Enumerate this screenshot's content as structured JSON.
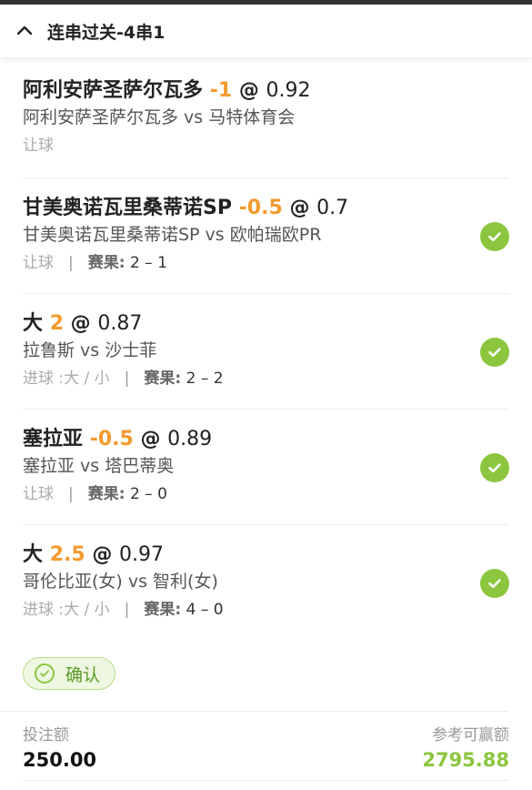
{
  "header": {
    "title": "连串过关-4串1"
  },
  "bets": [
    {
      "selection": "阿利安萨圣萨尔瓦多",
      "handicap": "-1",
      "at": "@",
      "odds": "0.92",
      "match": "阿利安萨圣萨尔瓦多 vs 马特体育会",
      "market": "让球",
      "result_label": "",
      "result": "",
      "won": false
    },
    {
      "selection": "甘美奥诺瓦里桑蒂诺SP",
      "handicap": "-0.5",
      "at": "@",
      "odds": "0.7",
      "match": "甘美奥诺瓦里桑蒂诺SP vs 欧帕瑞欧PR",
      "market": "让球",
      "result_label": "赛果:",
      "result": "2 – 1",
      "won": true
    },
    {
      "selection": "大",
      "handicap": "2",
      "at": "@",
      "odds": "0.87",
      "match": "拉鲁斯 vs 沙士菲",
      "market": "进球 :大 / 小",
      "result_label": "赛果:",
      "result": "2 – 2",
      "won": true
    },
    {
      "selection": "塞拉亚",
      "handicap": "-0.5",
      "at": "@",
      "odds": "0.89",
      "match": "塞拉亚 vs 塔巴蒂奥",
      "market": "让球",
      "result_label": "赛果:",
      "result": "2 – 0",
      "won": true
    },
    {
      "selection": "大",
      "handicap": "2.5",
      "at": "@",
      "odds": "0.97",
      "match": "哥伦比亚(女) vs 智利(女)",
      "market": "进球 :大 / 小",
      "result_label": "赛果:",
      "result": "4 – 0",
      "won": true
    }
  ],
  "confirm": {
    "label": "确认"
  },
  "summary": {
    "stake_label": "投注额",
    "stake": "250.00",
    "win_label": "参考可赢额",
    "win": "2795.88"
  },
  "colors": {
    "accent_orange": "#f29a2e",
    "accent_green": "#8cc63f"
  },
  "icons": {
    "header": "chevron-up-icon",
    "won": "check-circle-icon",
    "confirm": "check-circle-outline-icon"
  }
}
